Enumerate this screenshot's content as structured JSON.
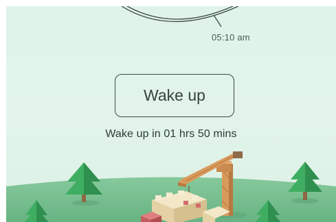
{
  "alarm": {
    "time": "05:10 am"
  },
  "wake_button": {
    "label": "Wake up"
  },
  "countdown": {
    "text": "Wake up in 01 hrs 50 mins"
  },
  "icons": {
    "dial": "clock-dial-arc",
    "trees": "pine-tree",
    "crane": "construction-crane",
    "building": "block-building"
  },
  "colors": {
    "background": "#dff3ea",
    "hill": "#7fc497",
    "text": "#36423e",
    "tree": "#2f9a57",
    "crane": "#d2955a"
  }
}
